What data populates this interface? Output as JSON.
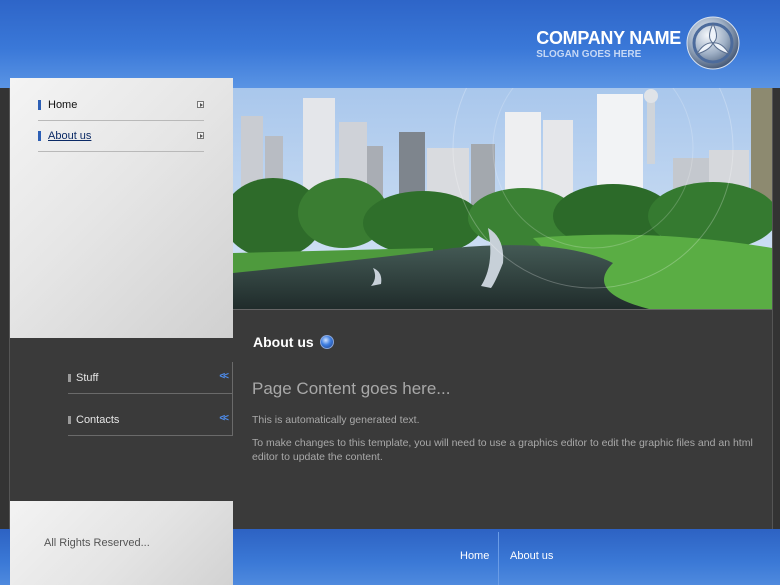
{
  "header": {
    "company_name": "COMPANY NAME",
    "slogan": "SLOGAN GOES HERE"
  },
  "nav": {
    "items": [
      {
        "label": "Home",
        "active": false
      },
      {
        "label": "About us",
        "active": true
      }
    ]
  },
  "content": {
    "section_title": "About us",
    "heading": "Page Content goes here...",
    "paragraphs": [
      "This is automatically generated text.",
      "To make changes to this template, you will need to use a graphics editor to edit the graphic files and an html editor to update the content."
    ]
  },
  "submenu": {
    "items": [
      {
        "label": "Stuff"
      },
      {
        "label": "Contacts"
      }
    ]
  },
  "footer": {
    "copyright": "All Rights Reserved...",
    "links": [
      {
        "label": "Home"
      },
      {
        "label": "About us"
      }
    ]
  },
  "colors": {
    "header_blue": "#3a78d8",
    "dark_bg": "#3a3a3a",
    "accent_blue": "#2d5fb5"
  }
}
